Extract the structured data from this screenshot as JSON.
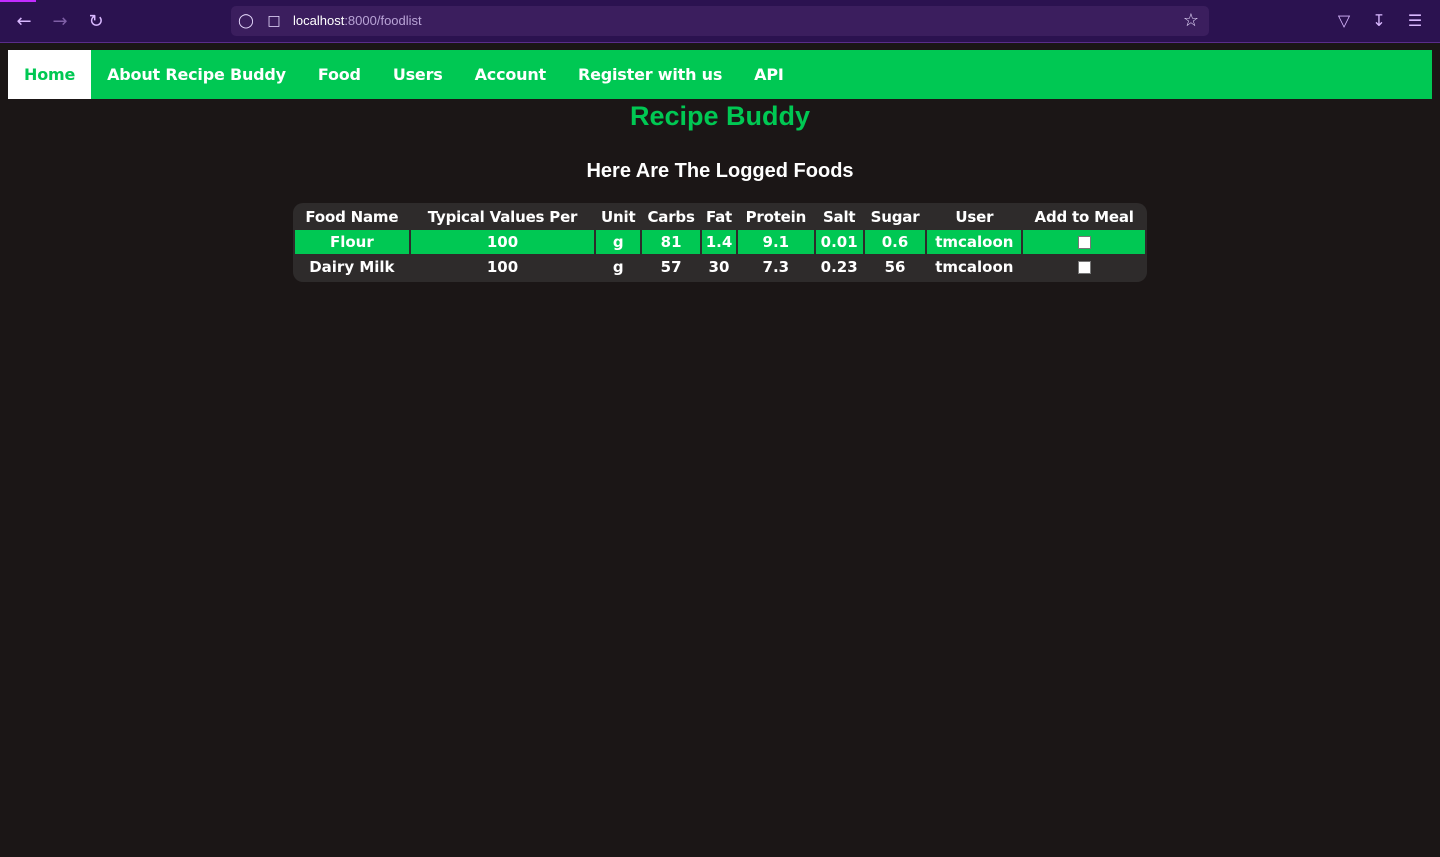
{
  "browser": {
    "url_host": "localhost",
    "url_path": ":8000/foodlist"
  },
  "nav": {
    "items": [
      {
        "label": "Home",
        "active": true
      },
      {
        "label": "About Recipe Buddy",
        "active": false
      },
      {
        "label": "Food",
        "active": false
      },
      {
        "label": "Users",
        "active": false
      },
      {
        "label": "Account",
        "active": false
      },
      {
        "label": "Register with us",
        "active": false
      },
      {
        "label": "API",
        "active": false
      }
    ]
  },
  "page": {
    "title": "Recipe Buddy",
    "subtitle": "Here Are The Logged Foods"
  },
  "table": {
    "headers": [
      "Food Name",
      "Typical Values Per",
      "Unit",
      "Carbs",
      "Fat",
      "Protein",
      "Salt",
      "Sugar",
      "User",
      "Add to Meal"
    ],
    "rows": [
      {
        "name": "Flour",
        "per": "100",
        "unit": "g",
        "carbs": "81",
        "fat": "1.4",
        "protein": "9.1",
        "salt": "0.01",
        "sugar": "0.6",
        "user": "tmcaloon",
        "checked": false
      },
      {
        "name": "Dairy Milk",
        "per": "100",
        "unit": "g",
        "carbs": "57",
        "fat": "30",
        "protein": "7.3",
        "salt": "0.23",
        "sugar": "56",
        "user": "tmcaloon",
        "checked": false
      }
    ]
  },
  "colors": {
    "accent": "#00c853",
    "background": "#1b1616",
    "browser_chrome": "#2b1250"
  }
}
